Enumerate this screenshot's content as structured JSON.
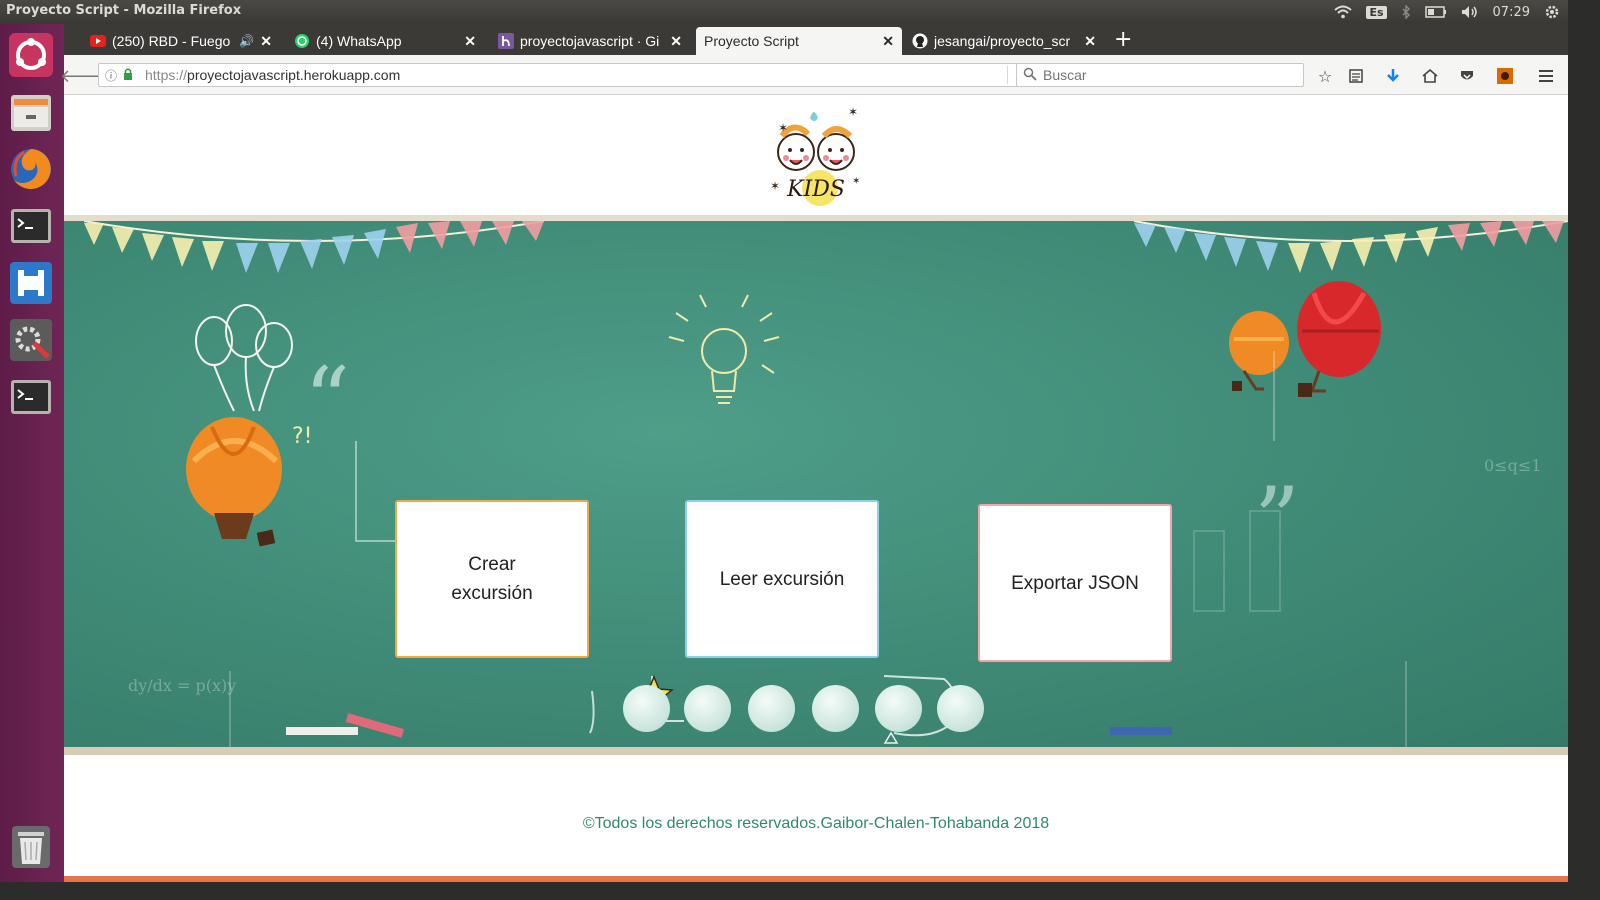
{
  "system": {
    "window_title": "Proyecto Script - Mozilla Firefox",
    "keyboard_layout": "Es",
    "clock": "07:29"
  },
  "launcher": {
    "items": [
      "ubuntu-dash",
      "files",
      "firefox",
      "terminal",
      "vscode",
      "system-settings",
      "terminal-2",
      "trash"
    ]
  },
  "browser": {
    "tabs": [
      {
        "label": "(250) RBD - Fuego (l",
        "favicon": "youtube-icon",
        "active": false
      },
      {
        "label": "(4) WhatsApp",
        "favicon": "whatsapp-icon",
        "active": false
      },
      {
        "label": "proyectojavascript · Gi",
        "favicon": "heroku-icon",
        "active": false
      },
      {
        "label": "Proyecto Script",
        "favicon": "",
        "active": true
      },
      {
        "label": "jesangai/proyecto_scr",
        "favicon": "github-icon",
        "active": false
      }
    ],
    "url_scheme": "https://",
    "url_host": "proyectojavascript.herokuapp.com",
    "search_placeholder": "Buscar"
  },
  "page": {
    "logo_text": "KIDS",
    "buttons": {
      "create": "Crear excursión",
      "read": "Leer excursión",
      "export": "Exportar JSON"
    },
    "carousel_dots": 6,
    "footer": "©Todos los derechos reservados.Gaibor-Chalen-Tohabanda 2018"
  },
  "colors": {
    "chalkboard": "#3f8a76",
    "create_border": "#f0a94a",
    "read_border": "#8fd0e8",
    "export_border": "#f2a6a8",
    "footer_text": "#2f8a6c",
    "footer_bar": "#e8744a",
    "launcher": "#5e1c48"
  }
}
